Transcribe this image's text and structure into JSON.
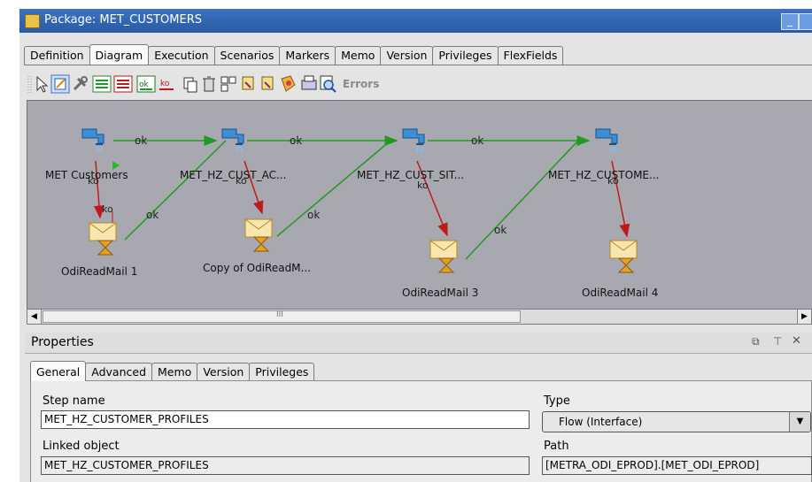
{
  "window": {
    "title": "Package: MET_CUSTOMERS",
    "minimize_label": "_"
  },
  "tabs": [
    "Definition",
    "Diagram",
    "Execution",
    "Scenarios",
    "Markers",
    "Memo",
    "Version",
    "Privileges",
    "FlexFields"
  ],
  "active_tab": "Diagram",
  "toolbar": {
    "icons": [
      "select-arrow-icon",
      "free-choice-icon",
      "wrench-icon",
      "next-step-ok-icon",
      "next-step-ko-icon",
      "ok-link-icon",
      "ko-link-icon",
      "copy-icon",
      "delete-icon",
      "duplicate-icon",
      "execute-step-icon",
      "execute-from-icon",
      "reorganize-icon",
      "print-icon",
      "zoom-icon"
    ],
    "errors_label": "Errors"
  },
  "diagram": {
    "steps": [
      {
        "label": "MET Customers",
        "kind": "interface"
      },
      {
        "label": "MET_HZ_CUST_AC...",
        "kind": "interface"
      },
      {
        "label": "MET_HZ_CUST_SIT...",
        "kind": "interface"
      },
      {
        "label": "MET_HZ_CUSTOME...",
        "kind": "interface"
      },
      {
        "label": "OdiReadMail 1",
        "kind": "mail"
      },
      {
        "label": "Copy of OdiReadM...",
        "kind": "mail"
      },
      {
        "label": "OdiReadMail 3",
        "kind": "mail"
      },
      {
        "label": "OdiReadMail 4",
        "kind": "mail"
      }
    ],
    "ok_label": "ok",
    "ko_label": "ko",
    "scroll_center": "III"
  },
  "properties": {
    "title": "Properties",
    "header_icons": [
      "float-icon",
      "pin-icon",
      "close-icon"
    ],
    "tabs": [
      "General",
      "Advanced",
      "Memo",
      "Version",
      "Privileges"
    ],
    "active_tab": "General",
    "step_name_label": "Step name",
    "step_name_value": "MET_HZ_CUSTOMER_PROFILES",
    "type_label": "Type",
    "type_value": "Flow (Interface)",
    "linked_object_label": "Linked object",
    "linked_object_value": "MET_HZ_CUSTOMER_PROFILES",
    "path_label": "Path",
    "path_value": "[METRA_ODI_EPROD].[MET_ODI_EPROD]"
  },
  "colors": {
    "ok_link": "#1f9a1f",
    "ko_link": "#c0191b",
    "canvas": "#a8a8b0",
    "titlebar": "#2f62ad"
  }
}
